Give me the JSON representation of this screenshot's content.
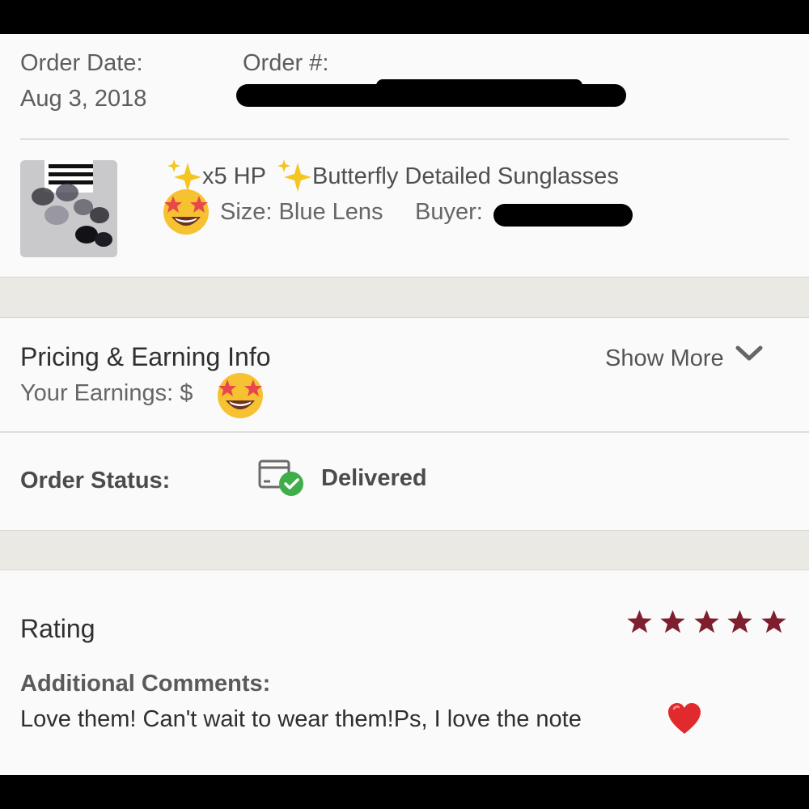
{
  "order": {
    "date_label": "Order Date:",
    "date_value": "Aug 3, 2018",
    "number_label": "Order #:"
  },
  "item": {
    "title_prefix": "x5 HP",
    "title_main": "Butterfly Detailed Sunglasses",
    "size_text": "Size: Blue Lens",
    "buyer_label": "Buyer:"
  },
  "pricing": {
    "heading": "Pricing & Earning Info",
    "earnings_label": "Your Earnings: $",
    "show_more_label": "Show More",
    "show_more_icon": "chevron-down-icon"
  },
  "status": {
    "label": "Order Status:",
    "value": "Delivered",
    "icon": "package-delivered-icon",
    "check_color": "#3fae49"
  },
  "rating": {
    "heading": "Rating",
    "stars": 5,
    "star_color": "#7d1f2e",
    "comments_label": "Additional Comments:",
    "comments_text": "Love them! Can't wait to wear them!Ps, I love the note"
  }
}
